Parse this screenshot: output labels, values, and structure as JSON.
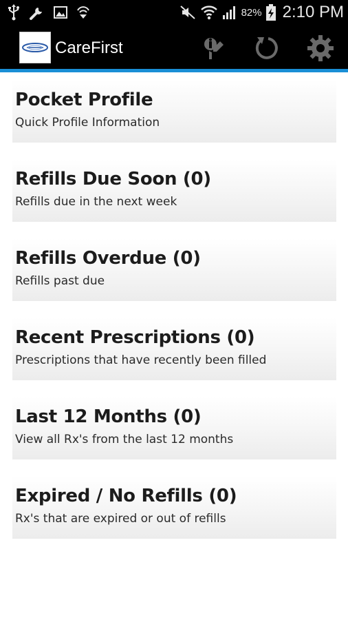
{
  "status_bar": {
    "battery_percent": "82%",
    "time": "2:10 PM",
    "icons": [
      "usb-icon",
      "wrench-icon",
      "image-icon",
      "sync-icon",
      "mute-icon",
      "wifi-icon",
      "signal-icon",
      "battery-charging-icon"
    ]
  },
  "action_bar": {
    "title": "CareFirst",
    "actions": [
      "info-icon",
      "refresh-icon",
      "settings-gear-icon"
    ],
    "accent_color": "#1a8fd6"
  },
  "menu": {
    "items": [
      {
        "title": "Pocket Profile",
        "subtitle": "Quick Profile Information"
      },
      {
        "title": "Refills Due Soon (0)",
        "subtitle": "Refills due in the next week"
      },
      {
        "title": "Refills Overdue (0)",
        "subtitle": "Refills past due"
      },
      {
        "title": "Recent Prescriptions (0)",
        "subtitle": "Prescriptions that have recently been filled"
      },
      {
        "title": "Last 12 Months (0)",
        "subtitle": "View all Rx's from the last 12 months"
      },
      {
        "title": "Expired / No Refills (0)",
        "subtitle": "Rx's that are expired or out of refills"
      }
    ]
  }
}
